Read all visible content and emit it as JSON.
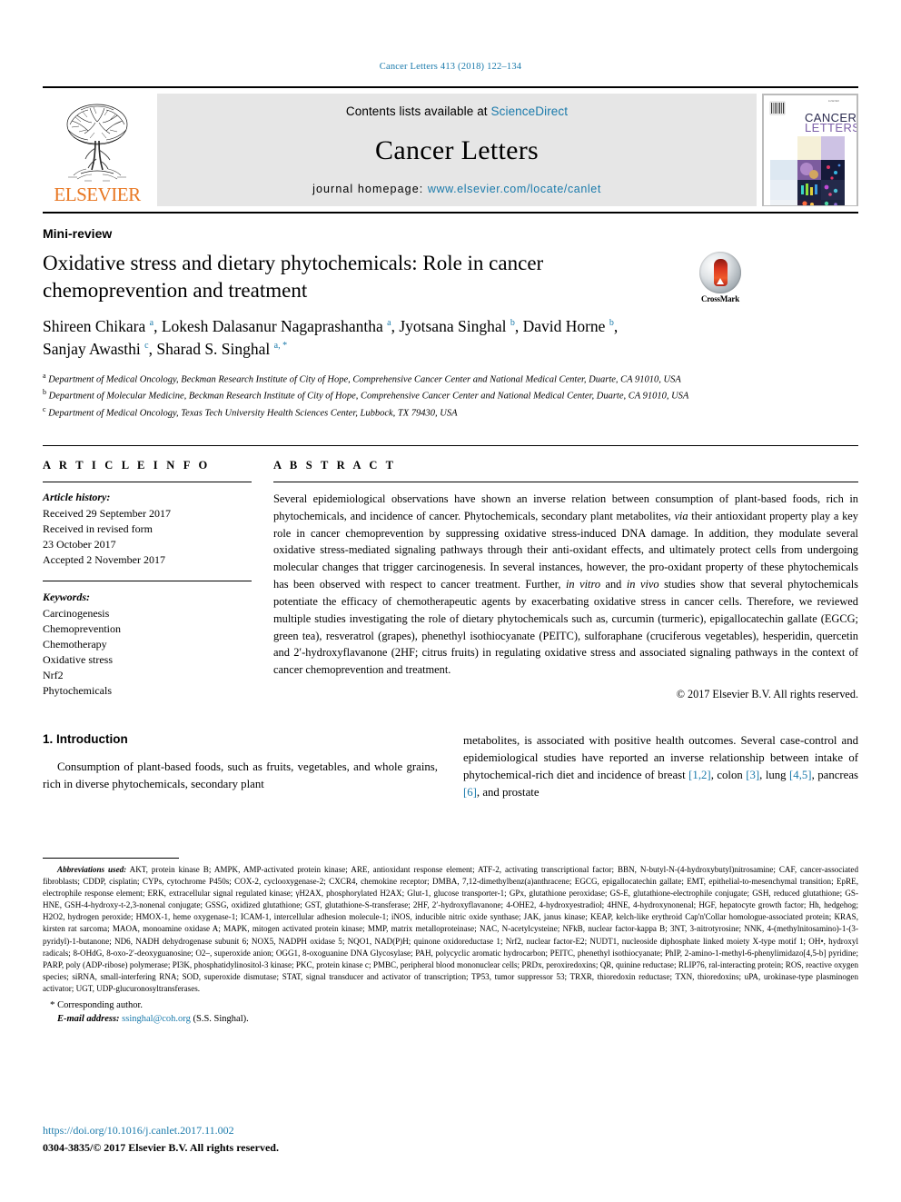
{
  "running_head": "Cancer Letters 413 (2018) 122–134",
  "masthead": {
    "publisher": "ELSEVIER",
    "contents_prefix": "Contents lists available at ",
    "contents_link": "ScienceDirect",
    "journal_name": "Cancer Letters",
    "homepage_prefix": "journal homepage: ",
    "homepage_link": "www.elsevier.com/locate/canlet",
    "cover_title_line1": "CANCER",
    "cover_title_line2": "LETTERS"
  },
  "article": {
    "type": "Mini-review",
    "title": "Oxidative stress and dietary phytochemicals: Role in cancer chemoprevention and treatment",
    "crossmark_label": "CrossMark",
    "authors_line1": "Shireen Chikara ",
    "authors_line1_sup1": "a",
    "authors_line1_b": ", Lokesh Dalasanur Nagaprashantha ",
    "authors_line1_sup2": "a",
    "authors_line1_c": ", Jyotsana Singhal ",
    "authors_line1_sup3": "b",
    "authors_line1_d": ", David Horne ",
    "authors_line1_sup4": "b",
    "authors_line1_e": ",",
    "authors_line2": "Sanjay Awasthi ",
    "authors_line2_sup1": "c",
    "authors_line2_b": ", Sharad S. Singhal ",
    "authors_line2_sup2": "a, *",
    "affiliations": [
      {
        "marker": "a",
        "text": "Department of Medical Oncology, Beckman Research Institute of City of Hope, Comprehensive Cancer Center and National Medical Center, Duarte, CA 91010, USA"
      },
      {
        "marker": "b",
        "text": "Department of Molecular Medicine, Beckman Research Institute of City of Hope, Comprehensive Cancer Center and National Medical Center, Duarte, CA 91010, USA"
      },
      {
        "marker": "c",
        "text": "Department of Medical Oncology, Texas Tech University Health Sciences Center, Lubbock, TX 79430, USA"
      }
    ]
  },
  "article_info": {
    "heading": "A R T I C L E   I N F O",
    "history_label": "Article history:",
    "history": [
      "Received 29 September 2017",
      "Received in revised form",
      "23 October 2017",
      "Accepted 2 November 2017"
    ],
    "keywords_label": "Keywords:",
    "keywords": [
      "Carcinogenesis",
      "Chemoprevention",
      "Chemotherapy",
      "Oxidative stress",
      "Nrf2",
      "Phytochemicals"
    ]
  },
  "abstract": {
    "heading": "A B S T R A C T",
    "part1": "Several epidemiological observations have shown an inverse relation between consumption of plant-based foods, rich in phytochemicals, and incidence of cancer. Phytochemicals, secondary plant metabolites, ",
    "via": "via",
    "part2": " their antioxidant property play a key role in cancer chemoprevention by suppressing oxidative stress-induced DNA damage. In addition, they modulate several oxidative stress-mediated signaling pathways through their anti-oxidant effects, and ultimately protect cells from undergoing molecular changes that trigger carcinogenesis. In several instances, however, the pro-oxidant property of these phytochemicals has been observed with respect to cancer treatment. Further, ",
    "invitro": "in vitro",
    "part3": " and ",
    "invivo": "in vivo",
    "part4": " studies show that several phytochemicals potentiate the efficacy of chemotherapeutic agents by exacerbating oxidative stress in cancer cells. Therefore, we reviewed multiple studies investigating the role of dietary phytochemicals such as, curcumin (turmeric), epigallocatechin gallate (EGCG; green tea), resveratrol (grapes), phenethyl isothiocyanate (PEITC), sulforaphane (cruciferous vegetables), hesperidin, quercetin and 2′-hydroxyflavanone (2HF; citrus fruits) in regulating oxidative stress and associated signaling pathways in the context of cancer chemoprevention and treatment.",
    "copyright": "© 2017 Elsevier B.V. All rights reserved."
  },
  "introduction": {
    "heading": "1.  Introduction",
    "left_paragraph": "Consumption of plant-based foods, such as fruits, vegetables, and whole grains, rich in diverse phytochemicals, secondary plant",
    "right_part1": "metabolites, is associated with positive health outcomes. Several case-control and epidemiological studies have reported an inverse relationship between intake of phytochemical-rich diet and incidence of breast ",
    "cite1": "[1,2]",
    "right_part2": ", colon ",
    "cite2": "[3]",
    "right_part3": ", lung ",
    "cite3": "[4,5]",
    "right_part4": ", pancreas ",
    "cite4": "[6]",
    "right_part5": ", and prostate"
  },
  "footnotes": {
    "abbrev_label": "Abbreviations used:",
    "abbrev_text": " AKT, protein kinase B; AMPK, AMP-activated protein kinase; ARE, antioxidant response element; ATF-2, activating transcriptional factor; BBN, N-butyl-N-(4-hydroxybutyl)nitrosamine; CAF, cancer-associated fibroblasts; CDDP, cisplatin; CYPs, cytochrome P450s; COX-2, cyclooxygenase-2; CXCR4, chemokine receptor; DMBA, 7,12-dimethylbenz(a)anthracene; EGCG, epigallocatechin gallate; EMT, epithelial-to-mesenchymal transition; EpRE, electrophile response element; ERK, extracellular signal regulated kinase; γH2AX, phosphorylated H2AX; Glut-1, glucose transporter-1; GPx, glutathione peroxidase; GS-E, glutathione-electrophile conjugate; GSH, reduced glutathione; GS-HNE, GSH-4-hydroxy-t-2,3-nonenal conjugate; GSSG, oxidized glutathione; GST, glutathione-S-transferase; 2HF, 2′-hydroxyflavanone; 4-OHE2, 4-hydroxyestradiol; 4HNE, 4-hydroxynonenal; HGF, hepatocyte growth factor; Hh, hedgehog; H2O2, hydrogen peroxide; HMOX-1, heme oxygenase-1; ICAM-1, intercellular adhesion molecule-1; iNOS, inducible nitric oxide synthase; JAK, janus kinase; KEAP, kelch-like erythroid Cap'n'Collar homologue-associated protein; KRAS, kirsten rat sarcoma; MAOA, monoamine oxidase A; MAPK, mitogen activated protein kinase; MMP, matrix metalloproteinase; NAC, N-acetylcysteine; NFkB, nuclear factor-kappa B; 3NT, 3-nitrotyrosine; NNK, 4-(methylnitosamino)-1-(3-pyridyl)-1-butanone; ND6, NADH dehydrogenase subunit 6; NOX5, NADPH oxidase 5; NQO1, NAD(P)H; quinone oxidoreductase 1; Nrf2, nuclear factor-E2; NUDT1, nucleoside diphosphate linked moiety X-type motif 1; OH•, hydroxyl radicals; 8-OHdG, 8-oxo-2′-deoxyguanosine; O2–, superoxide anion; OGG1, 8-oxoguanine DNA Glycosylase; PAH, polycyclic aromatic hydrocarbon; PEITC, phenethyl isothiocyanate; PhIP, 2-amino-1-methyl-6-phenylimidazo[4,5-b] pyridine; PARP, poly (ADP-ribose) polymerase; PI3K, phosphatidylinositol-3 kinase; PKC, protein kinase c; PMBC, peripheral blood mononuclear cells; PRDx, peroxiredoxins; QR, quinine reductase; RLIP76, ral-interacting protein; ROS, reactive oxygen species; siRNA, small-interfering RNA; SOD, superoxide dismutase; STAT, signal transducer and activator of transcription; TP53, tumor suppressor 53; TRXR, thioredoxin reductase; TXN, thioredoxins; uPA, urokinase-type plasminogen activator; UGT, UDP-glucuronosyltransferases.",
    "corresponding": "Corresponding author.",
    "email_label": "E-mail address:",
    "email": "ssinghal@coh.org",
    "email_suffix": " (S.S. Singhal).",
    "doi": "https://doi.org/10.1016/j.canlet.2017.11.002",
    "issn": "0304-3835/© 2017 Elsevier B.V. All rights reserved."
  }
}
